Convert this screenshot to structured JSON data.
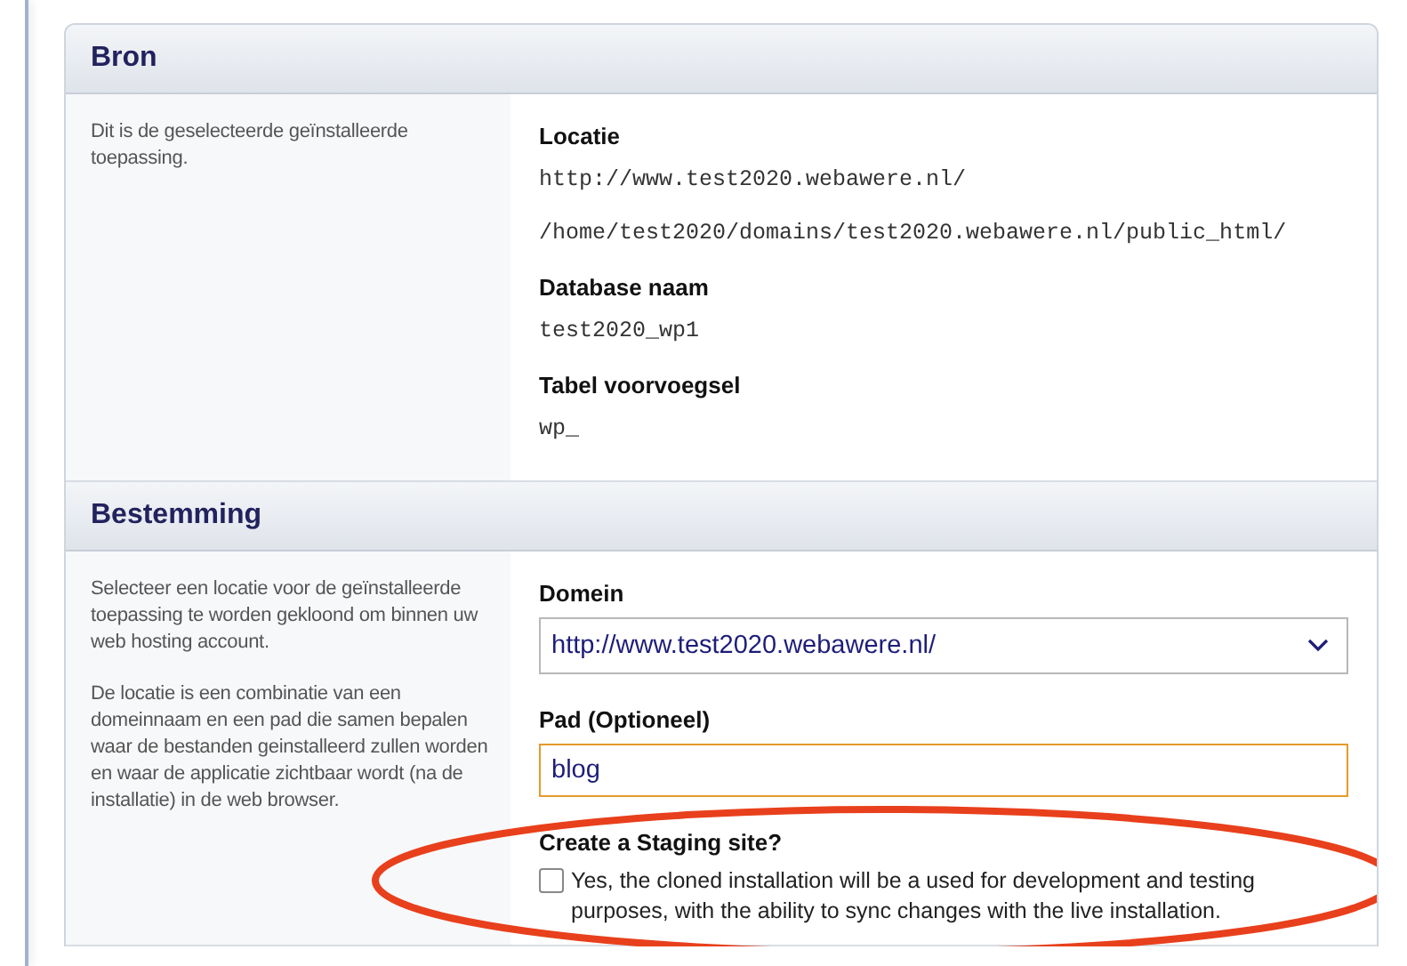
{
  "sections": [
    {
      "title": "Bron",
      "description": [
        "Dit is de geselecteerde geïnstalleerde toepassing."
      ],
      "fields": [
        {
          "kind": "info",
          "label": "Locatie",
          "values": [
            "http://www.test2020.webawere.nl/",
            "/home/test2020/domains/test2020.webawere.nl/public_html/"
          ]
        },
        {
          "kind": "info",
          "label": "Database naam",
          "values": [
            "test2020_wp1"
          ]
        },
        {
          "kind": "info",
          "label": "Tabel voorvoegsel",
          "values": [
            "wp_"
          ]
        }
      ]
    },
    {
      "title": "Bestemming",
      "description": [
        "Selecteer een locatie voor de geïnstalleerde toepassing te worden gekloond om binnen uw web hosting account.",
        "De locatie is een combinatie van een domeinnaam en een pad die samen bepalen waar de bestanden geinstalleerd zullen worden en waar de applicatie zichtbaar wordt (na de installatie) in de web browser."
      ],
      "fields": [
        {
          "kind": "select",
          "label": "Domein",
          "value": "http://www.test2020.webawere.nl/"
        },
        {
          "kind": "text",
          "label": "Pad (Optioneel)",
          "value": "blog",
          "focused": true
        },
        {
          "kind": "checkbox",
          "label": "Create a Staging site?",
          "option": "Yes, the cloned installation will be a used for development and testing purposes, with the ability to sync changes with the live installation.",
          "checked": false
        }
      ]
    }
  ]
}
